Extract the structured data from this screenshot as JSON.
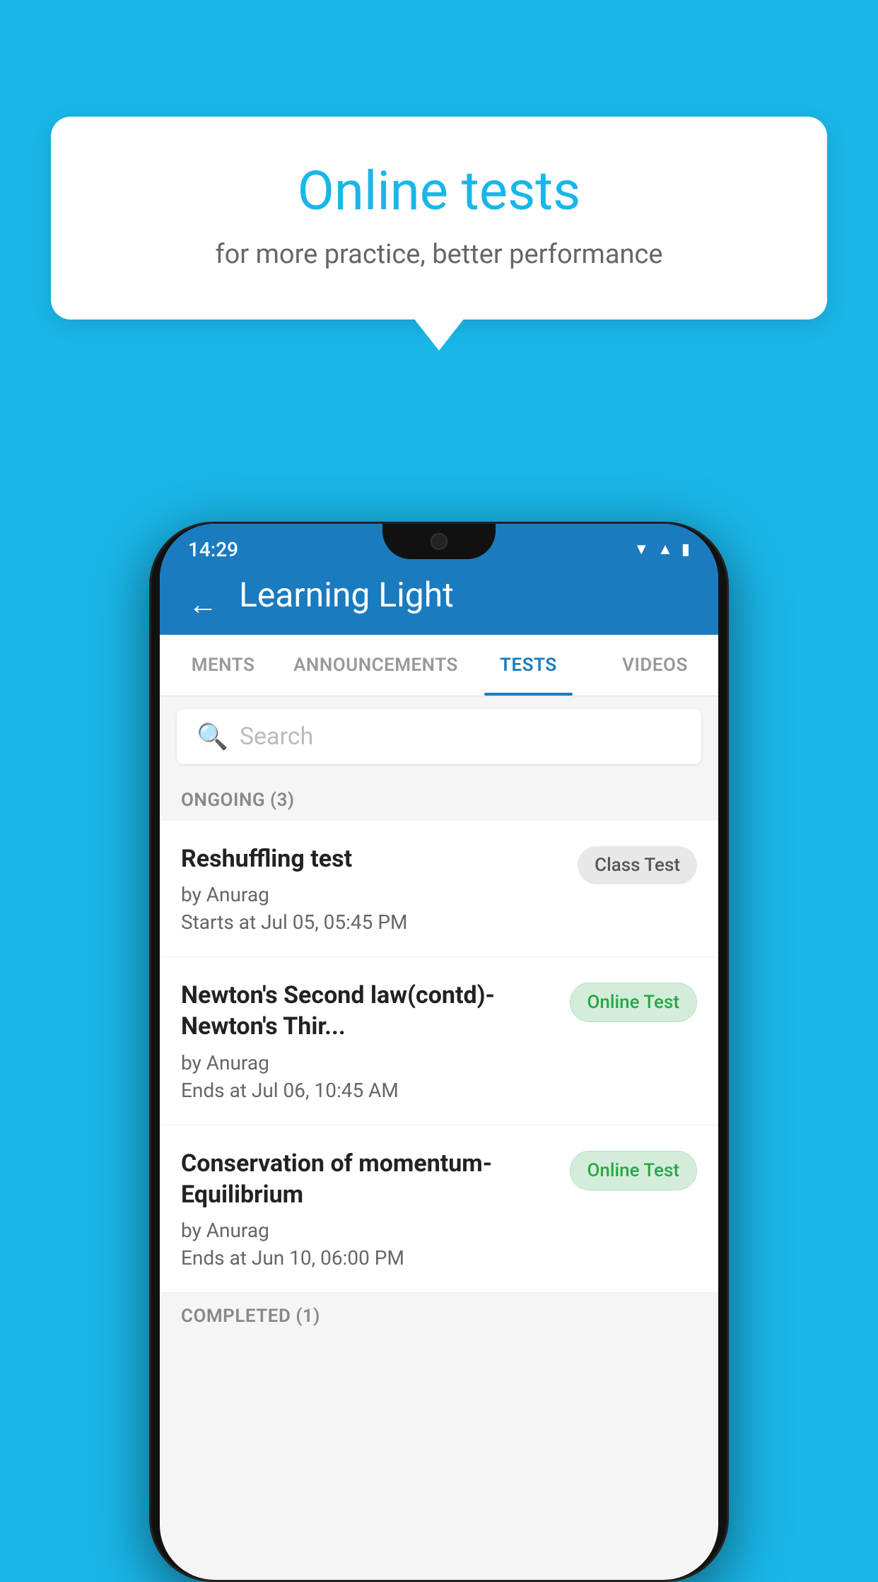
{
  "background": {
    "color": "#1ab6e8"
  },
  "promo": {
    "title": "Online tests",
    "subtitle": "for more practice, better performance"
  },
  "phone": {
    "status": {
      "time": "14:29",
      "wifi_icon": "▼",
      "signal_icon": "▲",
      "battery_icon": "▮"
    },
    "app": {
      "title": "Learning Light",
      "back_label": "←",
      "tabs": [
        {
          "label": "MENTS",
          "active": false
        },
        {
          "label": "ANNOUNCEMENTS",
          "active": false
        },
        {
          "label": "TESTS",
          "active": true
        },
        {
          "label": "VIDEOS",
          "active": false
        }
      ],
      "search": {
        "placeholder": "Search"
      },
      "ongoing_section": "ONGOING (3)",
      "tests": [
        {
          "name": "Reshuffling test",
          "by": "by Anurag",
          "date": "Starts at  Jul 05, 05:45 PM",
          "badge": "Class Test",
          "badge_type": "class"
        },
        {
          "name": "Newton's Second law(contd)-Newton's Thir...",
          "by": "by Anurag",
          "date": "Ends at  Jul 06, 10:45 AM",
          "badge": "Online Test",
          "badge_type": "online"
        },
        {
          "name": "Conservation of momentum-Equilibrium",
          "by": "by Anurag",
          "date": "Ends at  Jun 10, 06:00 PM",
          "badge": "Online Test",
          "badge_type": "online"
        }
      ],
      "completed_section": "COMPLETED (1)"
    }
  }
}
